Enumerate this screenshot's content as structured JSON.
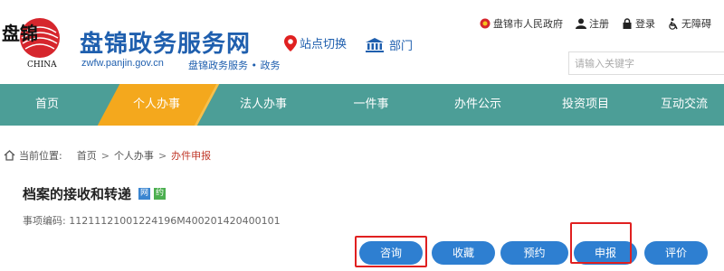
{
  "header": {
    "logo_text": "盘锦",
    "logo_sub": "CHINA",
    "site_title": "盘锦政务服务网",
    "site_url": "zwfw.panjin.gov.cn",
    "site_sub": "盘锦政务服务 • 政务",
    "location_switch": "站点切换",
    "dept_label": "部门",
    "top_links": {
      "gov": "盘锦市人民政府",
      "register": "注册",
      "login": "登录",
      "accessibility": "无障碍"
    },
    "search_placeholder": "请输入关键字"
  },
  "nav": {
    "items": [
      {
        "label": "首页"
      },
      {
        "label": "个人办事"
      },
      {
        "label": "法人办事"
      },
      {
        "label": "一件事"
      },
      {
        "label": "办件公示"
      },
      {
        "label": "投资项目"
      },
      {
        "label": "互动交流"
      }
    ],
    "active_index": 1
  },
  "breadcrumb": {
    "prefix": "当前位置:",
    "home": "首页",
    "level1": "个人办事",
    "current": "办件申报"
  },
  "item": {
    "title": "档案的接收和转递",
    "badge_web": "网",
    "badge_appt": "约",
    "code_label": "事项编码:",
    "code_value": "11211121001224196M400201420400101"
  },
  "actions": {
    "consult": "咨询",
    "favorite": "收藏",
    "reserve": "预约",
    "apply": "申报",
    "rate": "评价"
  },
  "colors": {
    "brand_blue": "#1f5fae",
    "nav_bg": "#4c9e97",
    "nav_active": "#f4a81d",
    "button_blue": "#2e7fd1",
    "highlight_red": "#e02020"
  }
}
